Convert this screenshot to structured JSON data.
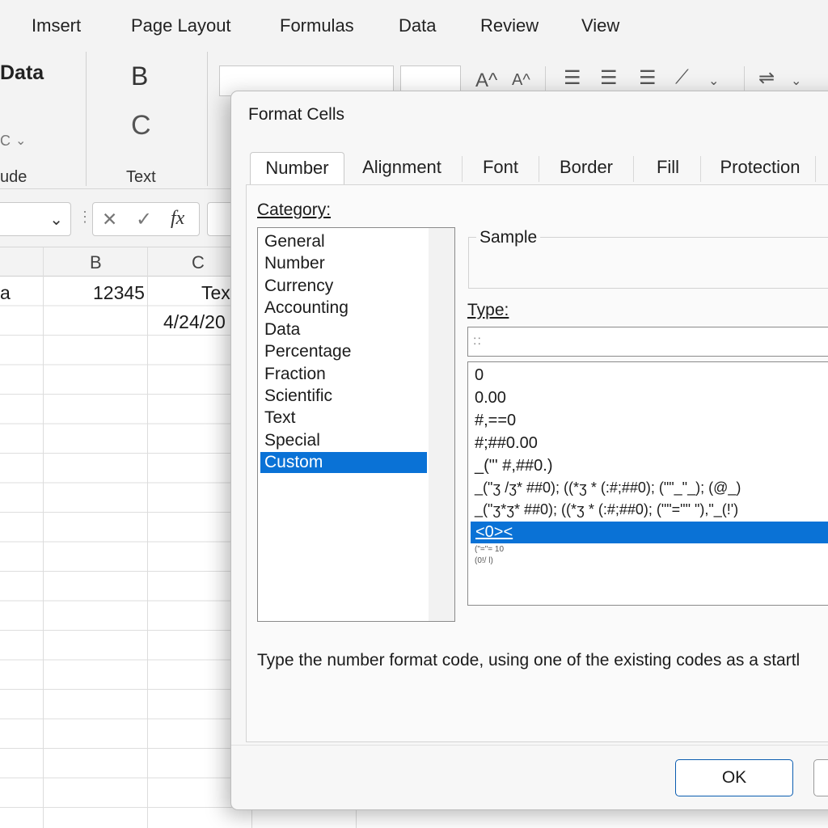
{
  "ribbon": {
    "tabs": [
      "Imsert",
      "Page Layout",
      "Formulas",
      "Data",
      "Review",
      "View"
    ],
    "data_group": {
      "big_label": "Data",
      "bottom_label": "ude",
      "small_glyph": "C"
    },
    "text_group": {
      "label": "Text",
      "bold_letter": "B",
      "glyph2": "C"
    },
    "font_size_up_icon": "A^",
    "font_size_down_icon": "A^"
  },
  "formula_bar": {
    "name_box_value": "",
    "cancel_icon": "✕",
    "enter_icon": "✓",
    "function_icon": "fx"
  },
  "grid": {
    "column_headers": [
      "B",
      "C"
    ],
    "cells": {
      "a1": "a",
      "b1": "12345",
      "c1": "Tex",
      "c2": "4/24/20"
    }
  },
  "dialog": {
    "title": "Format Cells",
    "tabs": [
      "Number",
      "Alignment",
      "Font",
      "Border",
      "Fill",
      "Protection"
    ],
    "active_tab": "Number",
    "category_label": "Category:",
    "categories": [
      "General",
      "Number",
      "Currency",
      "Accounting",
      "Data",
      "Percentage",
      "Fraction",
      "Scientific",
      "Text",
      "Special",
      "Custom"
    ],
    "selected_category": "Custom",
    "sample_label": "Sample",
    "type_label": "Type:",
    "type_input_value": "::",
    "formats": [
      "0",
      "0.00",
      "#,==0",
      "#;##0.00",
      "_(\"' #,##0.)",
      "_(\"ʒ /ʒ* ##0); ((*ʒ * (:#;##0); (\"\"_\"_); (@_)",
      "_(\"ʒ*ʒ* ##0); ((*ʒ * (:#;##0); (\"\"=\"\" \"),\"_(!')",
      "<0><",
      "(\"=\"= 10",
      "(0!/ l)"
    ],
    "selected_format": "<0><",
    "hint": "Type the number format code, using one of the existing codes as a startl",
    "ok_label": "OK",
    "cancel_label": ""
  },
  "colors": {
    "accent": "#0a72d6",
    "ribbon_bg": "#f3f3f3",
    "dialog_bg": "#f7f7f7"
  }
}
